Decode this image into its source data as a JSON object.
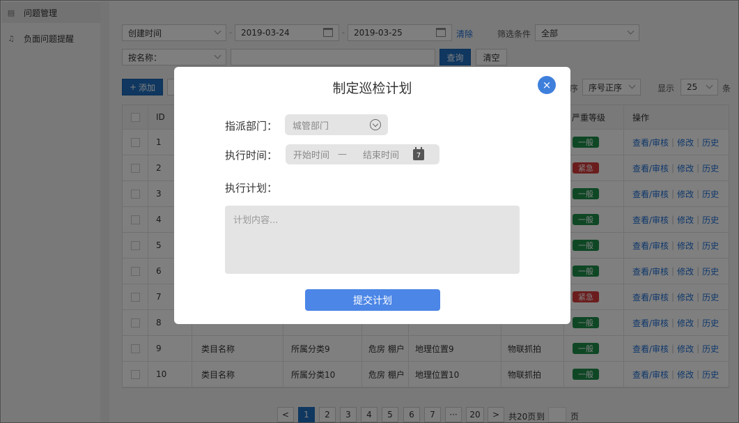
{
  "sidebar": {
    "items": [
      {
        "label": "问题管理",
        "icon": "clipboard-icon",
        "active": true
      },
      {
        "label": "负面问题提醒",
        "icon": "bell-icon",
        "active": false
      }
    ]
  },
  "filters": {
    "time_field": "创建时间",
    "start_date": "2019-03-24",
    "end_date": "2019-03-25",
    "clear_link": "清除",
    "filter_label": "筛选条件",
    "filter_value": "全部",
    "name_field": "按名称：",
    "search_value": "",
    "query_button": "查询",
    "reset_button": "清空"
  },
  "toolbar": {
    "add_button": "添加",
    "sort_prefix": "序",
    "sort_value": "序号正序",
    "show_label": "显示",
    "page_size": "25",
    "page_size_unit": "条"
  },
  "table": {
    "headers": {
      "id": "ID",
      "level": "严重等级",
      "ops": "操作"
    },
    "rows": [
      {
        "id": "1",
        "level": "一般"
      },
      {
        "id": "2",
        "level": "紧急"
      },
      {
        "id": "3",
        "level": "一般"
      },
      {
        "id": "4",
        "level": "一般"
      },
      {
        "id": "5",
        "level": "一般"
      },
      {
        "id": "6",
        "level": "一般"
      },
      {
        "id": "7",
        "level": "紧急"
      },
      {
        "id": "8",
        "level": "一般"
      },
      {
        "id": "9",
        "category": "类目名称",
        "type": "所属分类9",
        "tag": "危房 棚户",
        "location": "地理位置9",
        "source": "物联抓拍",
        "level": "一般"
      },
      {
        "id": "10",
        "category": "类目名称",
        "type": "所属分类10",
        "tag": "危房 棚户",
        "location": "地理位置10",
        "source": "物联抓拍",
        "level": "一般"
      }
    ],
    "actions": [
      "查看/审核",
      "修改",
      "历史"
    ]
  },
  "pagination": {
    "prev": "<",
    "pages": [
      "1",
      "2",
      "3",
      "4",
      "5",
      "6",
      "7",
      "···",
      "20"
    ],
    "next": ">",
    "total": "共20页",
    "goto_label": "到",
    "goto_value": "",
    "page_unit": "页"
  },
  "modal": {
    "title": "制定巡检计划",
    "close_icon": "×",
    "dept_label": "指派部门：",
    "dept_value": "城管部门",
    "time_label": "执行时间：",
    "start_placeholder": "开始时间",
    "range_dash": "—",
    "end_placeholder": "结束时间",
    "calendar_day": "7",
    "plan_label": "执行计划：",
    "plan_placeholder": "计划内容...",
    "submit": "提交计划"
  },
  "colors": {
    "primary": "#1e6fc1",
    "badge_green": "#1f8f4a",
    "badge_red": "#d63a3a",
    "modal_button": "#4c86e6",
    "close_button": "#3f7fdc"
  }
}
